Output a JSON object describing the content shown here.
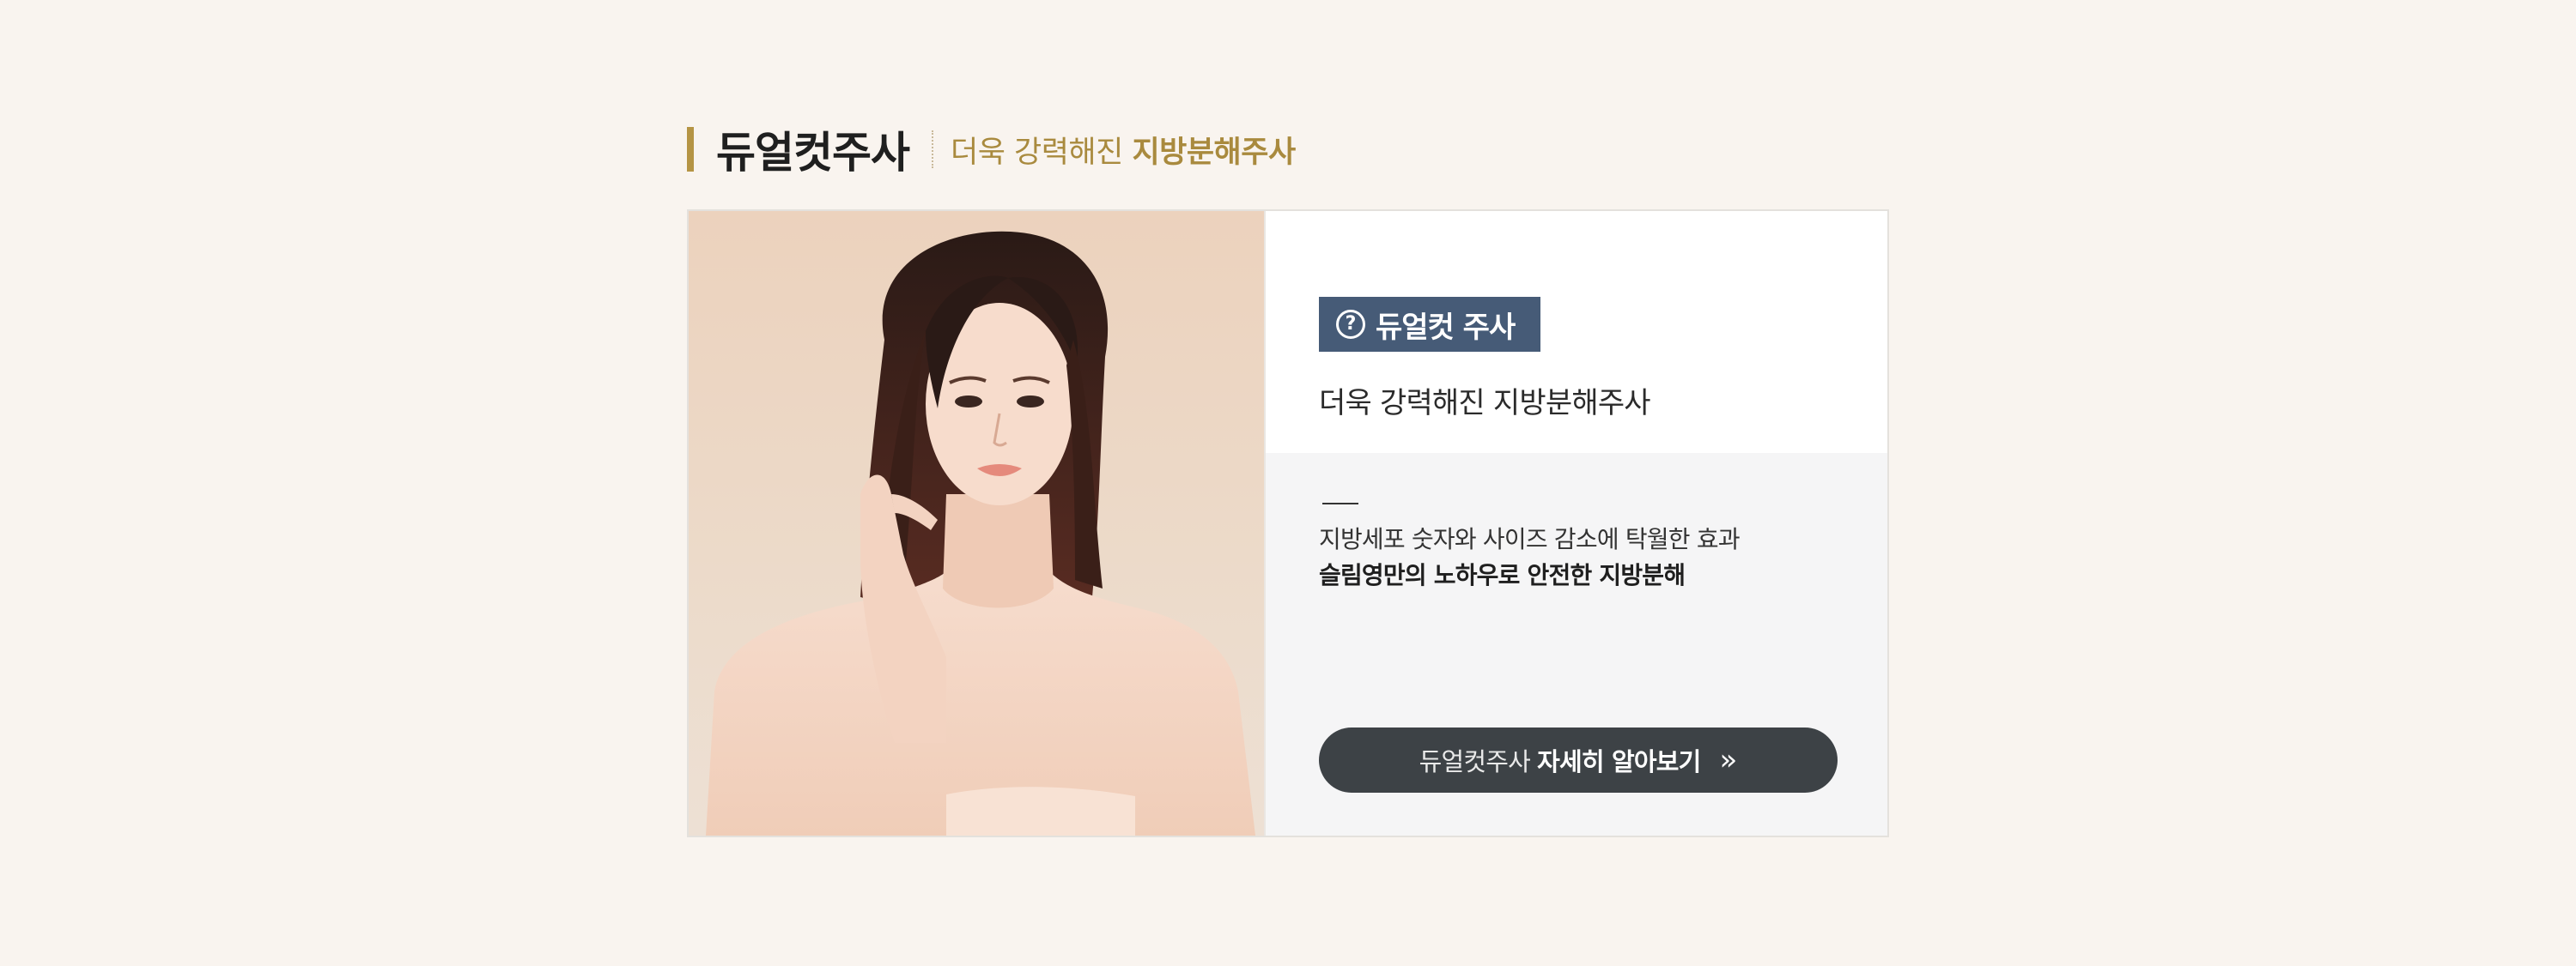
{
  "header": {
    "title": "듀얼컷주사",
    "subtitle_normal": "더욱 강력해진 ",
    "subtitle_strong": "지방분해주사"
  },
  "card": {
    "photo_alt": "woman portrait",
    "badge": {
      "icon": "question-circle-icon",
      "label": "듀얼컷 주사"
    },
    "subtitle": "더욱 강력해진 지방분해주사",
    "description": {
      "line1": "지방세포 숫자와 사이즈 감소에 탁월한 효과",
      "line2": "슬림영만의 노하우로 안전한 지방분해"
    },
    "button": {
      "label_normal": "듀얼컷주사",
      "label_bold": "자세히 알아보기",
      "icon": "double-chevron-right-icon"
    }
  },
  "colors": {
    "page_background": "#f9f4ef",
    "accent_gold": "#b59444",
    "badge_navy": "#465b77",
    "button_dark": "#3d4246",
    "panel_gray": "#f5f5f6"
  }
}
